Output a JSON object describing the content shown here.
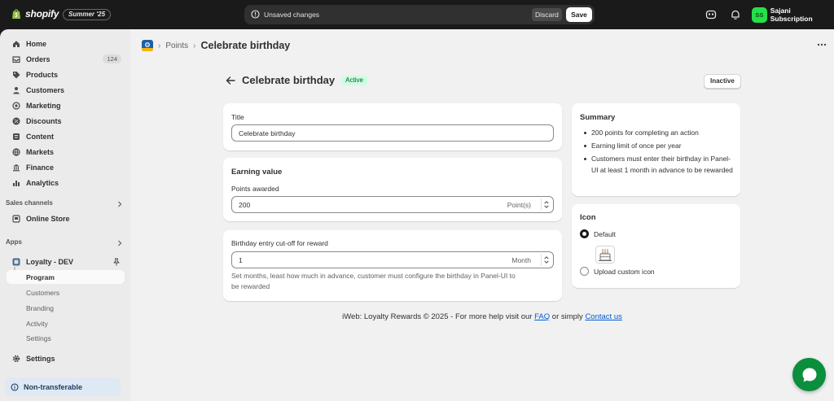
{
  "topbar": {
    "brand": "shopify",
    "edition_badge": "Summer '25",
    "unsaved_message": "Unsaved changes",
    "discard_label": "Discard",
    "save_label": "Save",
    "user_initials": "SS",
    "user_name": "Sajani Subscription",
    "icons": [
      "shopify-bag-icon",
      "info-icon",
      "sidekick-icon",
      "bell-icon"
    ]
  },
  "sidebar": {
    "items": [
      {
        "label": "Home",
        "icon": "home-icon"
      },
      {
        "label": "Orders",
        "icon": "orders-icon",
        "badge": "124"
      },
      {
        "label": "Products",
        "icon": "tag-icon"
      },
      {
        "label": "Customers",
        "icon": "person-icon"
      },
      {
        "label": "Marketing",
        "icon": "target-icon"
      },
      {
        "label": "Discounts",
        "icon": "discount-icon"
      },
      {
        "label": "Content",
        "icon": "content-icon"
      },
      {
        "label": "Markets",
        "icon": "globe-icon"
      },
      {
        "label": "Finance",
        "icon": "bank-icon"
      },
      {
        "label": "Analytics",
        "icon": "bar-chart-icon"
      }
    ],
    "sales_channels_title": "Sales channels",
    "online_store": "Online Store",
    "apps_title": "Apps",
    "app_name": "Loyalty - DEV",
    "app_subitems": [
      "Program",
      "Customers",
      "Branding",
      "Activity",
      "Settings"
    ],
    "settings": "Settings",
    "non_transferable": "Non-transferable"
  },
  "breadcrumb": {
    "parent": "Points",
    "separator": "›",
    "current": "Celebrate birthday"
  },
  "page": {
    "title": "Celebrate birthday",
    "status": "Active",
    "toggle_button": "Inactive"
  },
  "title_card": {
    "label": "Title",
    "value": "Celebrate birthday"
  },
  "earning_card": {
    "heading": "Earning value",
    "points_label": "Points awarded",
    "points_value": "200",
    "points_suffix": "Point(s)"
  },
  "cutoff_card": {
    "label": "Birthday entry cut-off for reward",
    "value": "1",
    "suffix": "Month",
    "help_line1": "Set months, least how much in advance, customer must configure the birthday in Panel-UI to",
    "help_line2": "be rewarded"
  },
  "summary": {
    "heading": "Summary",
    "bullets": [
      "200 points for completing an action",
      "Earning limit of once per year",
      "Customers must enter their birthday in Panel-UI at least 1 month in advance to be rewarded"
    ]
  },
  "icon_card": {
    "heading": "Icon",
    "default_label": "Default",
    "custom_label": "Upload custom icon",
    "selected": "Default",
    "preview_icon": "birthday-cake-icon"
  },
  "footer": {
    "text": "iWeb: Loyalty Rewards © 2025 - For more help visit our",
    "faq": "FAQ",
    "middle": "or simply",
    "contact": "Contact us"
  },
  "colors": {
    "topbar_bg": "#1a1a1a",
    "sidebar_bg": "#ebebeb",
    "main_bg": "#f1f1f1",
    "active_badge_bg": "#cdfee1",
    "link": "#005bd3",
    "chat_button": "#0a8f3c",
    "avatar_bg": "#25e04a"
  }
}
